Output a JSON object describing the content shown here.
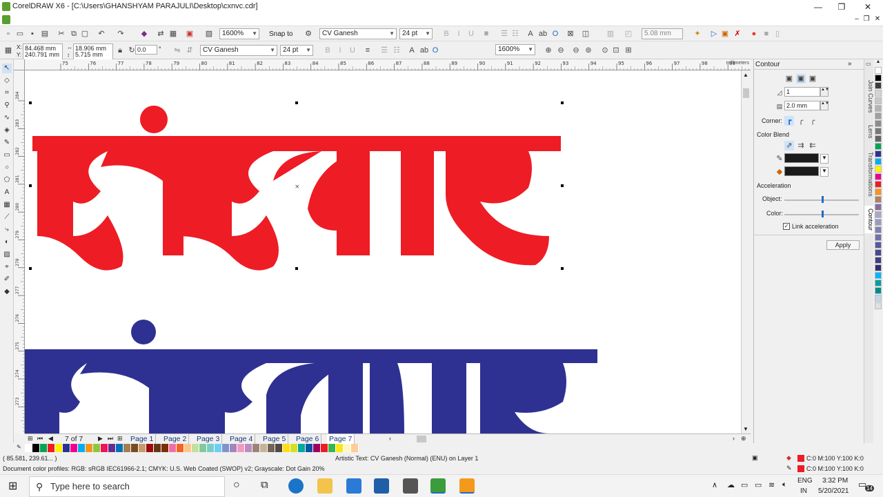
{
  "window": {
    "title": "CorelDRAW X6 - [C:\\Users\\GHANSHYAM PARAJULI\\Desktop\\cxnvc.cdr]",
    "minimize": "—",
    "restore": "❐",
    "close": "✕"
  },
  "toolbar1": {
    "zoom": "1600%",
    "snap": "Snap to",
    "font": "CV Ganesh",
    "size": "24 pt",
    "nudge": "5.08 mm"
  },
  "toolbar2": {
    "x": "84.468 mm",
    "y": "240.791 mm",
    "w": "18.906 mm",
    "h": "5.715 mm",
    "angle": "0.0",
    "degree": "°",
    "font": "CV Ganesh",
    "size": "24 pt",
    "zoom": "1600%"
  },
  "ruler": {
    "unit": "millimeters",
    "h_ticks": [
      "75",
      "76",
      "77",
      "78",
      "79",
      "80",
      "81",
      "82",
      "83",
      "84",
      "85",
      "86",
      "87",
      "88",
      "89",
      "90",
      "91",
      "92",
      "93",
      "94",
      "95",
      "96",
      "97",
      "98",
      "99"
    ],
    "v_ticks": [
      "284",
      "283",
      "282",
      "281",
      "280",
      "279",
      "278",
      "277",
      "276",
      "275",
      "274",
      "273"
    ]
  },
  "canvas": {
    "word": "संस्कार",
    "colors": {
      "red": "#ee1c25",
      "blue": "#2e3192"
    }
  },
  "pages": {
    "counter": "7 of 7",
    "tabs": [
      "Page 1",
      "Page 2",
      "Page 3",
      "Page 4",
      "Page 5",
      "Page 6",
      "Page 7"
    ],
    "active": "Page 7"
  },
  "palette": [
    "#ffffff",
    "#000000",
    "#00a651",
    "#ee1c25",
    "#fff200",
    "#2e3192",
    "#ec008c",
    "#00aeef",
    "#f7941d",
    "#8dc63f",
    "#ed145b",
    "#662d91",
    "#0072bc",
    "#a67c52",
    "#754c24",
    "#c69c6d",
    "#9e0b0f",
    "#603913",
    "#7b2e00",
    "#ef6ea8",
    "#f26522",
    "#fdc689",
    "#c4df9b",
    "#82ca9c",
    "#7accc8",
    "#6dcff6",
    "#8393ca",
    "#a186be",
    "#f49ac1",
    "#bd8cbf",
    "#998675",
    "#c7b299",
    "#736357",
    "#534741",
    "#ffde17",
    "#d7df23",
    "#00a99d",
    "#0054a6",
    "#9e005d",
    "#ed1c24",
    "#39b54a",
    "#f8e71c",
    "#fff8c4",
    "#ffcc99"
  ],
  "status": {
    "coords": "( 85.581, 239.61... )",
    "object": "Artistic Text: CV Ganesh (Normal) (ENU) on Layer 1",
    "profiles": "Document color profiles: RGB: sRGB IEC61966-2.1; CMYK: U.S. Web Coated (SWOP) v2; Grayscale: Dot Gain 20%",
    "fill": "C:0 M:100 Y:100 K:0",
    "outline": "C:0 M:100 Y:100 K:0"
  },
  "docker": {
    "title": "Contour",
    "steps": "1",
    "offset": "2.0 mm",
    "corner_label": "Corner:",
    "color_blend": "Color Blend",
    "acceleration": "Acceleration",
    "object_label": "Object:",
    "color_label": "Color:",
    "object_accel": 0.5,
    "color_accel": 0.5,
    "link": "Link acceleration",
    "apply": "Apply",
    "tabs": [
      "Join Curves",
      "Lens",
      "Transformations",
      "Contour"
    ]
  },
  "color_column": [
    "#ffffff",
    "#000000",
    "#3c3c3c",
    "#d4d4d4",
    "#c8c8c8",
    "#b4b4b4",
    "#a0a0a0",
    "#8c8c8c",
    "#787878",
    "#646464",
    "#00a651",
    "#2e3192",
    "#00aeef",
    "#fff200",
    "#ec008c",
    "#ee1c25",
    "#f7941d",
    "#b08060",
    "#8a6a9e",
    "#a8a8c8",
    "#9a9ac0",
    "#8080b0",
    "#7070a8",
    "#5858a0",
    "#484890",
    "#404080",
    "#303070",
    "#00b4ff",
    "#00a0a0",
    "#008c8c",
    "#c0d8e8",
    "#e0e0e0"
  ],
  "taskbar": {
    "search": "Type here to search",
    "lang1": "ENG",
    "lang2": "IN",
    "time": "3:32 PM",
    "date": "5/20/2021",
    "notif": "14"
  }
}
